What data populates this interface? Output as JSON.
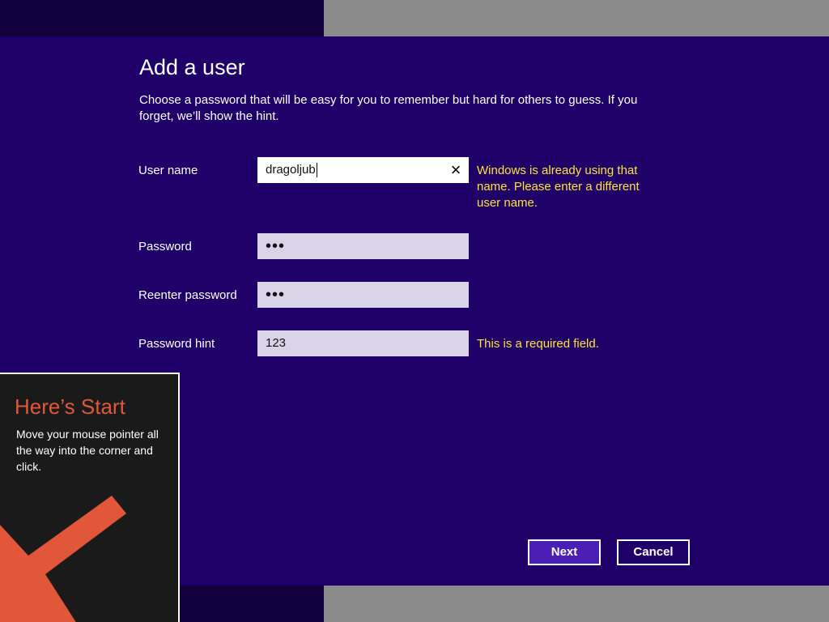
{
  "dialog": {
    "title": "Add a user",
    "intro": "Choose a password that will be easy for you to remember but hard for others to guess. If you forget, we’ll show the hint."
  },
  "fields": {
    "username": {
      "label": "User name",
      "value": "dragoljub",
      "error": "Windows is already using that name. Please enter a different user name.",
      "clear_icon": "×"
    },
    "password": {
      "label": "Password",
      "value": "•••"
    },
    "reenter": {
      "label": "Reenter password",
      "value": "•••"
    },
    "hint": {
      "label": "Password hint",
      "value": "123",
      "error": "This is a required field."
    }
  },
  "buttons": {
    "next": "Next",
    "cancel": "Cancel"
  },
  "tip": {
    "title": "Here’s Start",
    "body": "Move your mouse pointer all the way into the corner and click.",
    "arrow_icon": "arrow-down-left-icon"
  },
  "colors": {
    "background": "#1f0068",
    "accent": "#4b1fb5",
    "error_text": "#ffe23a",
    "tip_title": "#e2573a"
  }
}
